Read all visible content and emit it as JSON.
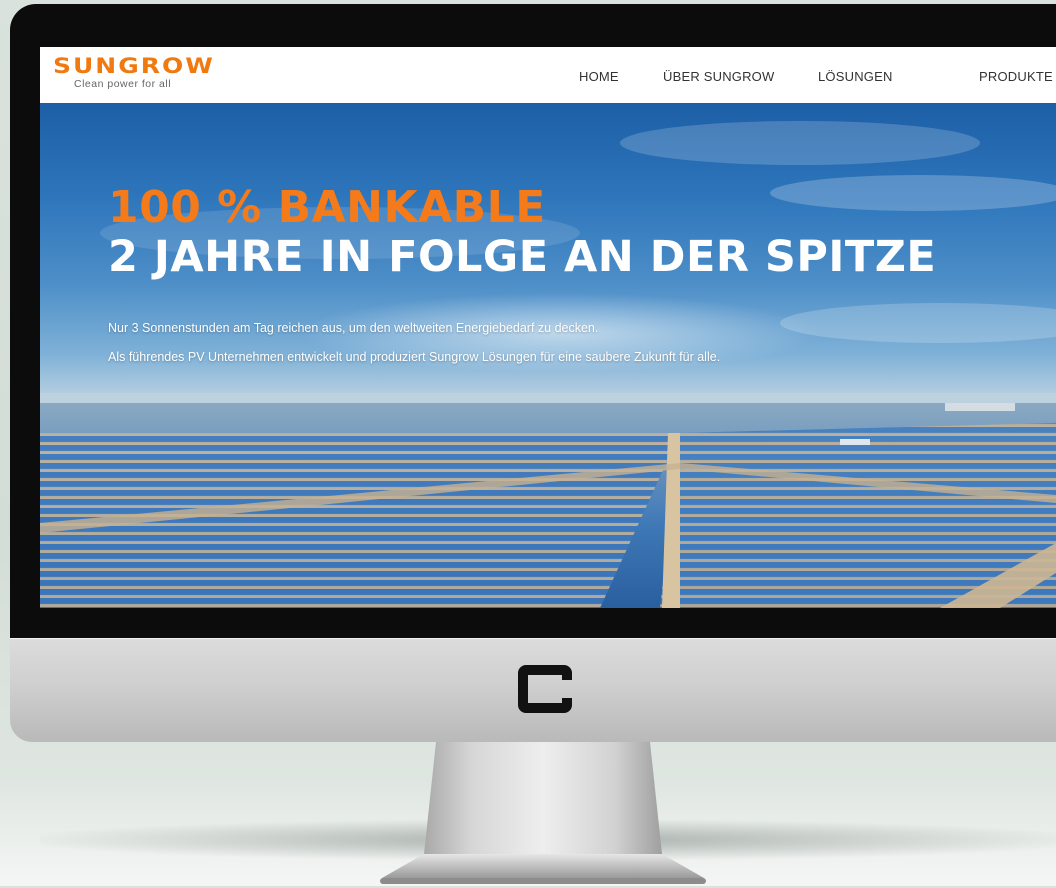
{
  "site": {
    "logo": {
      "wordmark": "SUNGROW",
      "tagline": "Clean power for all"
    },
    "nav": [
      {
        "label": "HOME"
      },
      {
        "label": "ÜBER SUNGROW"
      },
      {
        "label": "LÖSUNGEN"
      },
      {
        "label": "PRODUKTE"
      }
    ],
    "hero": {
      "headline_1": "100 % BANKABLE",
      "headline_2": "2 JAHRE IN FOLGE AN DER SPITZE",
      "paragraph_1": "Nur 3 Sonnenstunden am Tag reichen aus, um den weltweiten Energiebedarf zu decken.",
      "paragraph_2": "Als führendes PV Unternehmen entwickelt und produziert Sungrow Lösungen für eine saubere Zukunft für alle."
    }
  },
  "colors": {
    "brand_orange": "#f07a10",
    "headline_orange": "#f47a1a",
    "nav_text": "#333333",
    "bezel": "#0c0c0c"
  },
  "icons": {
    "monitor_logo": "rounded-square-logo-icon"
  }
}
